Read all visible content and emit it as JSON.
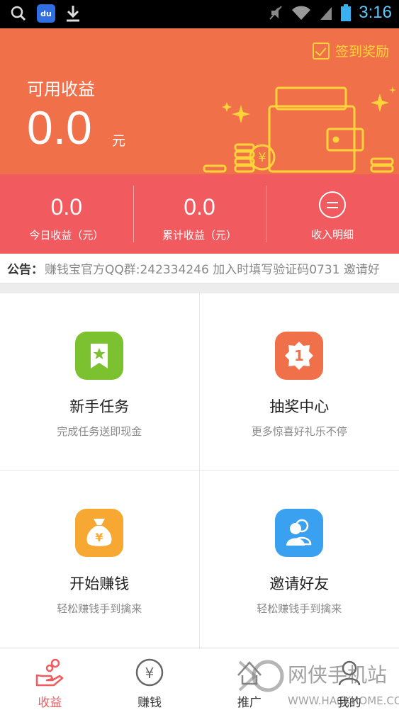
{
  "status_bar": {
    "time": "3:16",
    "baidu_label": "du",
    "icons": [
      "search-icon",
      "baidu-app-icon",
      "download-icon",
      "mute-icon",
      "wifi-icon",
      "signal-icon",
      "battery-icon"
    ]
  },
  "header": {
    "checkin_label": "签到奖励",
    "available_label": "可用收益",
    "available_value": "0.0",
    "available_unit": "元"
  },
  "stats": {
    "today_value": "0.0",
    "today_label": "今日收益（元）",
    "total_value": "0.0",
    "total_label": "累计收益（元）",
    "detail_label": "收入明细"
  },
  "notice": {
    "label": "公告：",
    "text": "赚钱宝官方QQ群:242334246 加入时填写验证码0731 邀请好"
  },
  "grid": {
    "items": [
      {
        "title": "新手任务",
        "subtitle": "完成任务送即现金",
        "icon": "bookmark-star-icon",
        "color": "#7cc12f"
      },
      {
        "title": "抽奖中心",
        "subtitle": "更多惊喜好礼乐不停",
        "icon": "badge-one-icon",
        "color": "#f0704a"
      },
      {
        "title": "开始赚钱",
        "subtitle": "轻松赚钱手到擒来",
        "icon": "money-bag-icon",
        "color": "#f7a833"
      },
      {
        "title": "邀请好友",
        "subtitle": "轻松赚钱手到擒来",
        "icon": "friends-icon",
        "color": "#3aa0f0"
      }
    ]
  },
  "nav": {
    "items": [
      {
        "label": "收益",
        "icon": "earnings-hand-icon",
        "active": true
      },
      {
        "label": "赚钱",
        "icon": "yen-circle-icon",
        "active": false
      },
      {
        "label": "推广",
        "icon": "promote-icon",
        "active": false
      },
      {
        "label": "我的",
        "icon": "profile-icon",
        "active": false
      }
    ]
  },
  "watermark": {
    "text": "网侠手机站",
    "url": "WWW.HACKHOME.COM"
  },
  "colors": {
    "header_bg": "#f0704a",
    "stats_bg": "#f15a5e",
    "checkin": "#ffd43b",
    "time": "#5fc8ff",
    "active_tab": "#f15a5e"
  }
}
